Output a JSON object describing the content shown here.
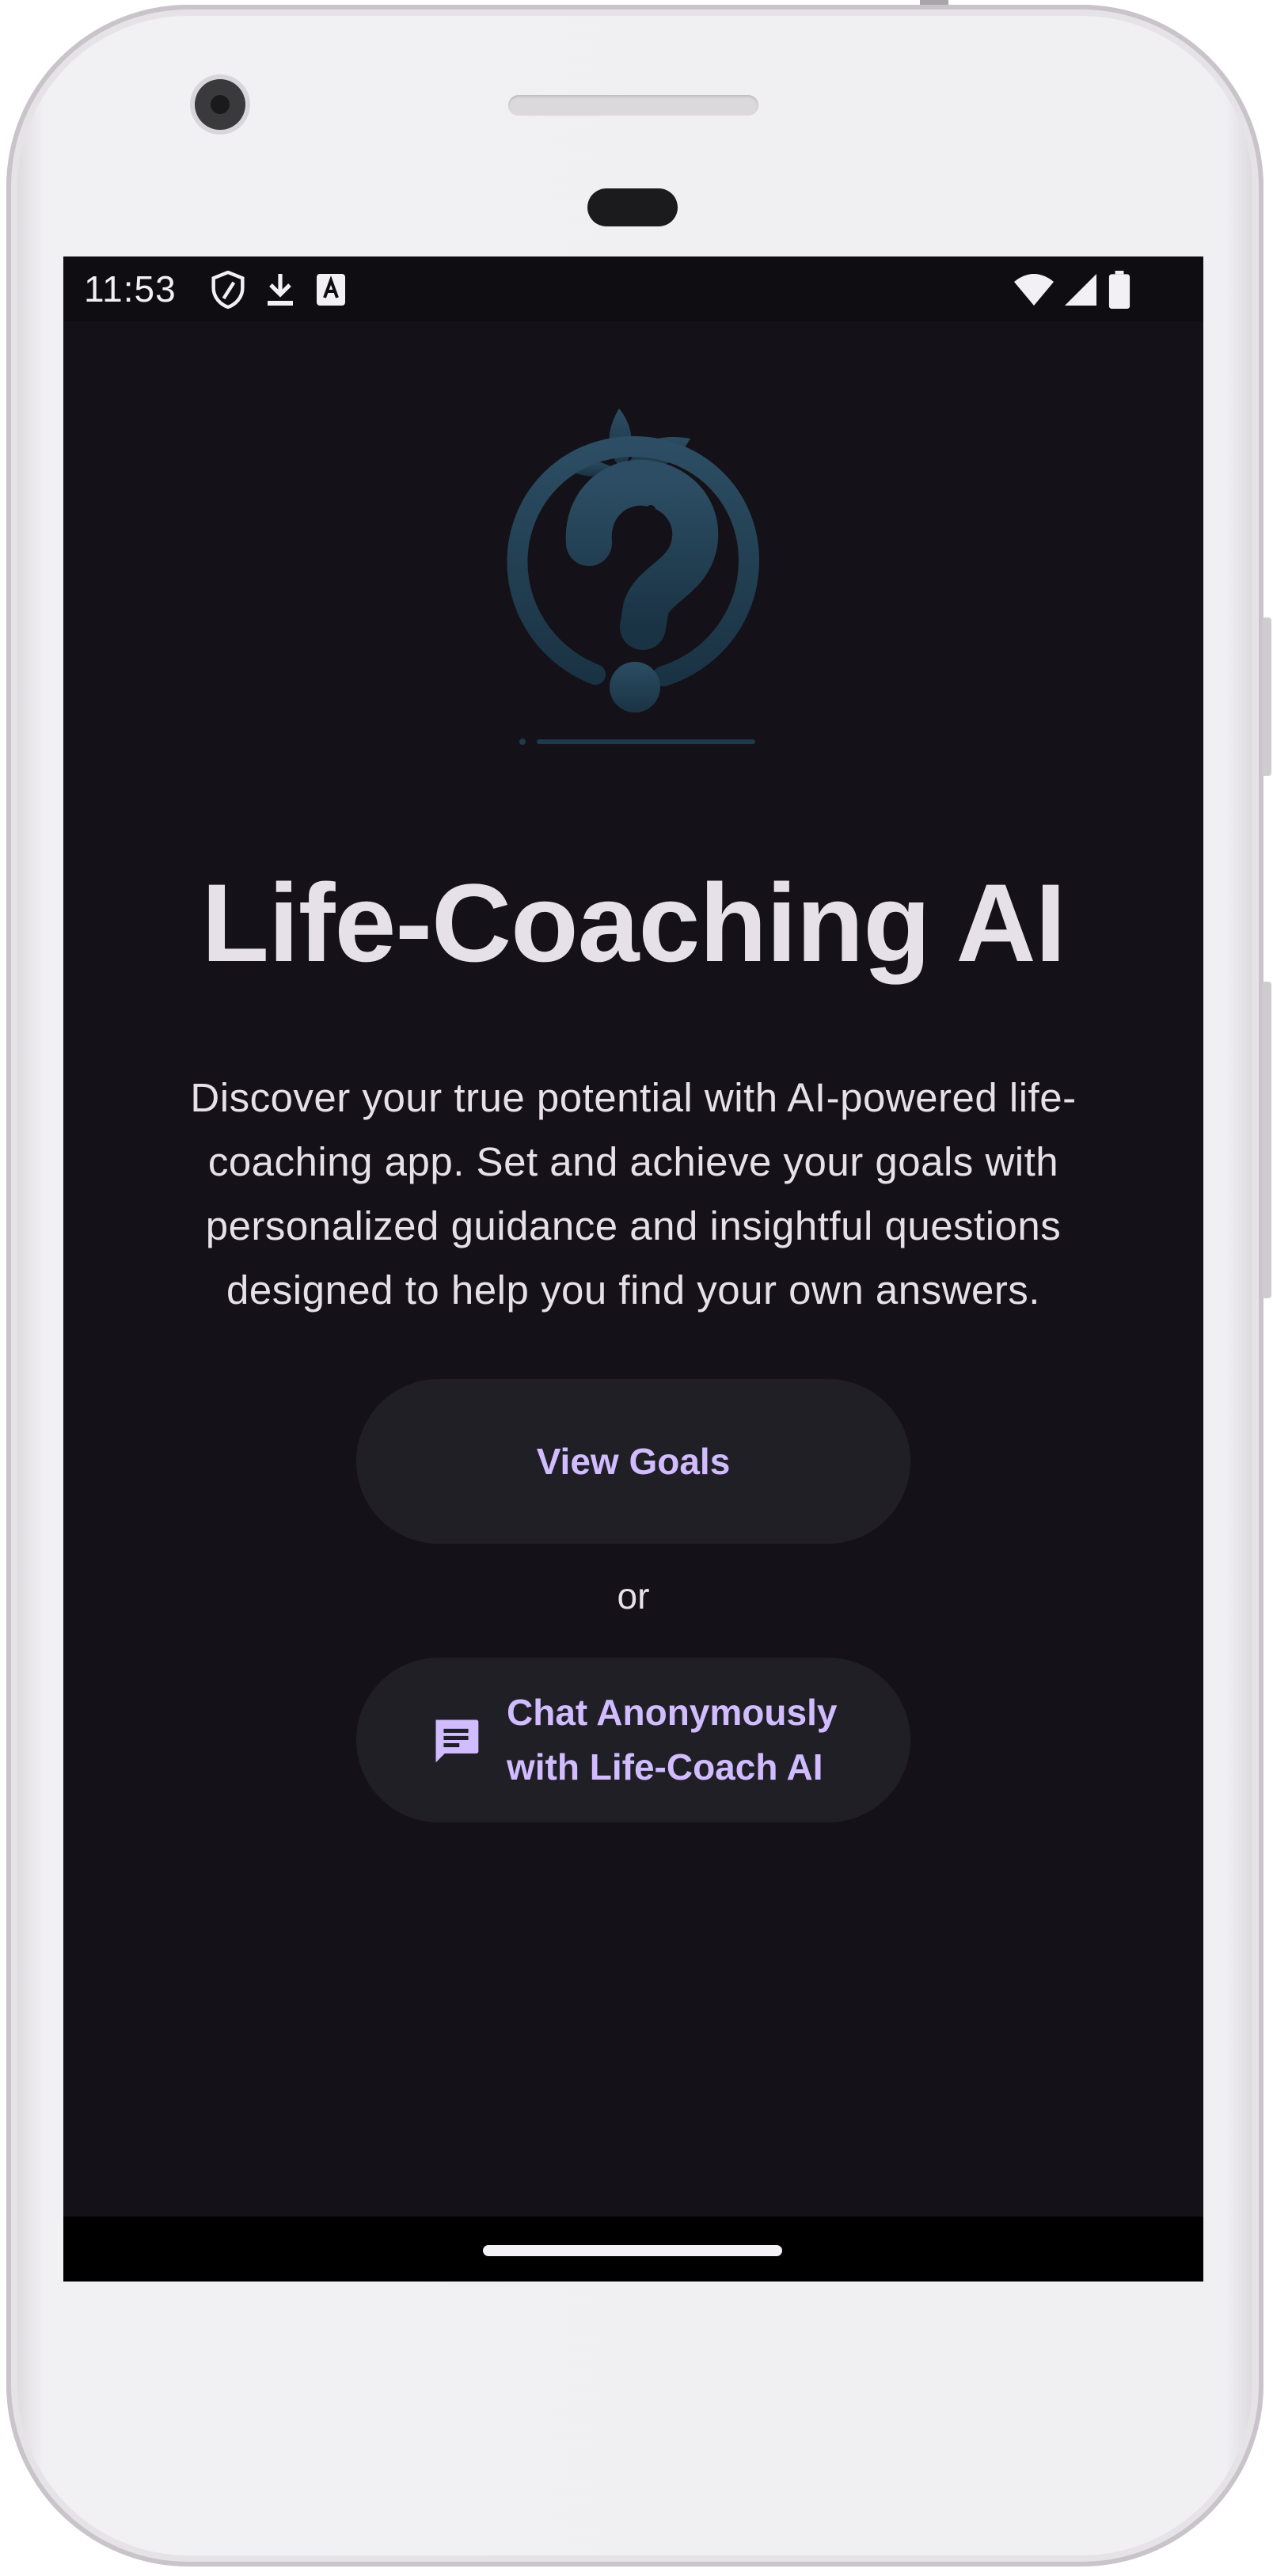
{
  "status_bar": {
    "time": "11:53",
    "left_icons": [
      "shield-icon",
      "download-icon",
      "font-icon"
    ],
    "right_icons": [
      "wifi-icon",
      "cellular-signal-icon",
      "battery-icon"
    ]
  },
  "logo": {
    "icon": "apple-question-mark-logo-icon",
    "color": "#2b4a60"
  },
  "main": {
    "title": "Life-Coaching AI",
    "description": "Discover your true potential with AI-powered life-coaching app. Set and achieve your goals with personalized guidance and insightful questions designed to help you find your own answers.",
    "view_goals_label": "View Goals",
    "or_label": "or",
    "chat_label": "Chat Anonymously with Life-Coach AI",
    "chat_icon": "chat-message-icon"
  },
  "colors": {
    "background": "#141218",
    "accent": "#d0bcff",
    "button_surface": "#211f26",
    "text": "#e6e0e9"
  }
}
